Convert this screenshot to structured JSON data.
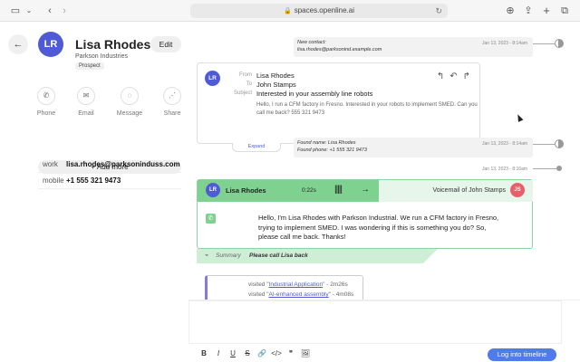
{
  "browser": {
    "url": "spaces.openline.ai"
  },
  "contact": {
    "initials": "LR",
    "name": "Lisa Rhodes",
    "edit_label": "Edit",
    "company": "Parkson Industries",
    "badge": "Prospect",
    "actions": [
      {
        "label": "Phone",
        "icon": "phone-icon"
      },
      {
        "label": "Email",
        "icon": "mail-icon"
      },
      {
        "label": "Message",
        "icon": "whatsapp-icon"
      },
      {
        "label": "Share",
        "icon": "share-icon"
      }
    ],
    "add_more_label": "Add more",
    "fields": [
      {
        "key": "work",
        "value": "lisa.rhodes@parksoninduss.com"
      },
      {
        "key": "mobile",
        "value": "+1 555 321 9473"
      }
    ]
  },
  "timeline": {
    "note1": {
      "line1": "New contact:",
      "line2": "lisa.rhodes@parksonind.example.com",
      "time": "Jan 13, 2023 - 8:14am"
    },
    "email": {
      "initials": "LR",
      "from_label": "From",
      "from": "Lisa Rhodes",
      "to_label": "To",
      "to": "John Stamps",
      "subject_label": "Subject",
      "subject": "Interested in your assembly line robots",
      "body": "Hello, I run a CFM factory in Fresno. Interested in your robots to implement SMED. Can you call me back? 555 321 9473",
      "expand": "Expand"
    },
    "note2": {
      "line1": "Found name: Lisa Rhodes",
      "line2": "Found phone: +1 555 321 9473",
      "time": "Jan 13, 2023 - 8:14am"
    },
    "marker_time": "Jan 13, 2023 - 8:16am",
    "voicemail": {
      "initials": "LR",
      "caller": "Lisa Rhodes",
      "duration": "0:22s",
      "title": "Voicemail of John Stamps",
      "recipient_initials": "JS",
      "transcript": "Hello, I'm Lisa Rhodes with Parkson Industrial. We run a CFM factory in Fresno, trying to implement SMED. I was wondering if this is something you do? So, please call me back. Thanks!",
      "summary_label": "Summary",
      "summary": "Please call Lisa back"
    },
    "web_visits": [
      {
        "prefix": "visited \"",
        "page": "Industrial Application",
        "suffix": "\" - 2m26s"
      },
      {
        "prefix": "visited \"",
        "page": "AI-enhanced assembly",
        "suffix": "\" - 4m08s"
      }
    ]
  },
  "editor": {
    "toolbar": [
      "B",
      "I",
      "U",
      "S",
      "🔗",
      "</>",
      "❞",
      "🖼"
    ],
    "log_button": "Log into timeline"
  }
}
